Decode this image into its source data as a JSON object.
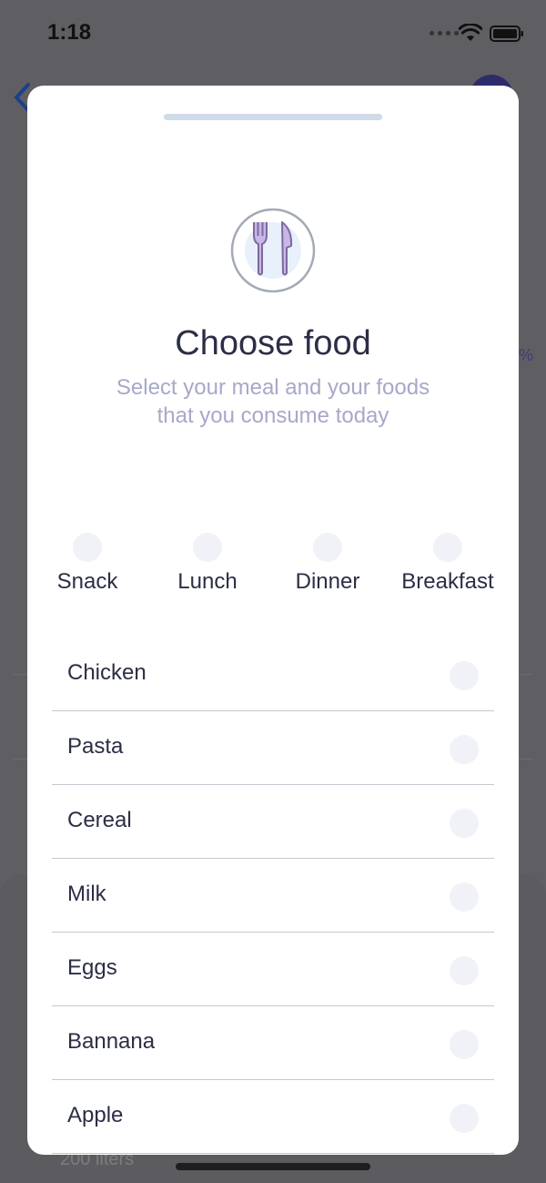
{
  "status_bar": {
    "time": "1:18"
  },
  "background": {
    "percent_fragment": "%",
    "liters_text": "200 liters"
  },
  "modal": {
    "title": "Choose food",
    "subtitle_line1": "Select your meal and your foods",
    "subtitle_line2": "that you consume today",
    "icon": "fork-knife-icon",
    "meals": [
      {
        "label": "Snack",
        "selected": false
      },
      {
        "label": "Lunch",
        "selected": false
      },
      {
        "label": "Dinner",
        "selected": false
      },
      {
        "label": "Breakfast",
        "selected": false
      }
    ],
    "foods": [
      {
        "name": "Chicken",
        "checked": false
      },
      {
        "name": "Pasta",
        "checked": false
      },
      {
        "name": "Cereal",
        "checked": false
      },
      {
        "name": "Milk",
        "checked": false
      },
      {
        "name": "Eggs",
        "checked": false
      },
      {
        "name": "Bannana",
        "checked": false
      },
      {
        "name": "Apple",
        "checked": false
      }
    ]
  },
  "colors": {
    "title": "#2b2e45",
    "subtitle": "#a7a8c9",
    "radio_fill": "#f1f2f8",
    "icon_accent": "#c9b6e8",
    "grabber": "#cfdbe6"
  }
}
